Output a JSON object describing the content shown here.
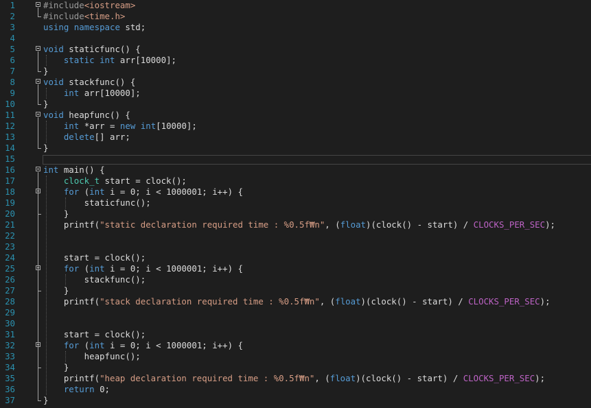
{
  "editor": {
    "lines": [
      {
        "n": "1",
        "fold": true,
        "tokens": [
          {
            "t": "#include",
            "c": "pp"
          },
          {
            "t": "<iostream>",
            "c": "inc"
          }
        ]
      },
      {
        "n": "2",
        "fold": false,
        "tokens": [
          {
            "t": "#include",
            "c": "pp"
          },
          {
            "t": "<time.h>",
            "c": "inc"
          }
        ]
      },
      {
        "n": "3",
        "fold": false,
        "tokens": [
          {
            "t": "using",
            "c": "kw"
          },
          {
            "t": " "
          },
          {
            "t": "namespace",
            "c": "kw"
          },
          {
            "t": " std;"
          }
        ]
      },
      {
        "n": "4",
        "fold": false,
        "tokens": []
      },
      {
        "n": "5",
        "fold": true,
        "tokens": [
          {
            "t": "void",
            "c": "kw"
          },
          {
            "t": " staticfunc() {"
          }
        ]
      },
      {
        "n": "6",
        "fold": false,
        "tokens": [
          {
            "t": "    "
          },
          {
            "t": "static",
            "c": "kw"
          },
          {
            "t": " "
          },
          {
            "t": "int",
            "c": "kw"
          },
          {
            "t": " arr[10000];"
          }
        ]
      },
      {
        "n": "7",
        "fold": false,
        "tokens": [
          {
            "t": "}"
          }
        ]
      },
      {
        "n": "8",
        "fold": true,
        "tokens": [
          {
            "t": "void",
            "c": "kw"
          },
          {
            "t": " stackfunc() {"
          }
        ]
      },
      {
        "n": "9",
        "fold": false,
        "tokens": [
          {
            "t": "    "
          },
          {
            "t": "int",
            "c": "kw"
          },
          {
            "t": " arr[10000];"
          }
        ]
      },
      {
        "n": "10",
        "fold": false,
        "tokens": [
          {
            "t": "}"
          }
        ]
      },
      {
        "n": "11",
        "fold": true,
        "tokens": [
          {
            "t": "void",
            "c": "kw"
          },
          {
            "t": " heapfunc() {"
          }
        ]
      },
      {
        "n": "12",
        "fold": false,
        "tokens": [
          {
            "t": "    "
          },
          {
            "t": "int",
            "c": "kw"
          },
          {
            "t": " *arr = "
          },
          {
            "t": "new",
            "c": "kw"
          },
          {
            "t": " "
          },
          {
            "t": "int",
            "c": "kw"
          },
          {
            "t": "[10000];"
          }
        ]
      },
      {
        "n": "13",
        "fold": false,
        "tokens": [
          {
            "t": "    "
          },
          {
            "t": "delete",
            "c": "kw"
          },
          {
            "t": "[] arr;"
          }
        ]
      },
      {
        "n": "14",
        "fold": false,
        "tokens": [
          {
            "t": "}"
          }
        ]
      },
      {
        "n": "15",
        "fold": false,
        "tokens": []
      },
      {
        "n": "16",
        "fold": true,
        "tokens": [
          {
            "t": "int",
            "c": "kw"
          },
          {
            "t": " main() {"
          }
        ]
      },
      {
        "n": "17",
        "fold": false,
        "tokens": [
          {
            "t": "    "
          },
          {
            "t": "clock_t",
            "c": "typ"
          },
          {
            "t": " start = clock();"
          }
        ]
      },
      {
        "n": "18",
        "fold": true,
        "tokens": [
          {
            "t": "    "
          },
          {
            "t": "for",
            "c": "kw"
          },
          {
            "t": " ("
          },
          {
            "t": "int",
            "c": "kw"
          },
          {
            "t": " i = 0; i < 1000001; i++) {"
          }
        ]
      },
      {
        "n": "19",
        "fold": false,
        "tokens": [
          {
            "t": "        staticfunc();"
          }
        ]
      },
      {
        "n": "20",
        "fold": false,
        "tokens": [
          {
            "t": "    }"
          }
        ]
      },
      {
        "n": "21",
        "fold": false,
        "tokens": [
          {
            "t": "    printf("
          },
          {
            "t": "\"static declaration required time : %0.5f₩n\"",
            "c": "str"
          },
          {
            "t": ", ("
          },
          {
            "t": "float",
            "c": "kw"
          },
          {
            "t": ")(clock() - start) / "
          },
          {
            "t": "CLOCKS_PER_SEC",
            "c": "mac"
          },
          {
            "t": ");"
          }
        ]
      },
      {
        "n": "22",
        "fold": false,
        "tokens": []
      },
      {
        "n": "23",
        "fold": false,
        "tokens": []
      },
      {
        "n": "24",
        "fold": false,
        "tokens": [
          {
            "t": "    start = clock();"
          }
        ]
      },
      {
        "n": "25",
        "fold": true,
        "tokens": [
          {
            "t": "    "
          },
          {
            "t": "for",
            "c": "kw"
          },
          {
            "t": " ("
          },
          {
            "t": "int",
            "c": "kw"
          },
          {
            "t": " i = 0; i < 1000001; i++) {"
          }
        ]
      },
      {
        "n": "26",
        "fold": false,
        "tokens": [
          {
            "t": "        stackfunc();"
          }
        ]
      },
      {
        "n": "27",
        "fold": false,
        "tokens": [
          {
            "t": "    }"
          }
        ]
      },
      {
        "n": "28",
        "fold": false,
        "tokens": [
          {
            "t": "    printf("
          },
          {
            "t": "\"stack declaration required time : %0.5f₩n\"",
            "c": "str"
          },
          {
            "t": ", ("
          },
          {
            "t": "float",
            "c": "kw"
          },
          {
            "t": ")(clock() - start) / "
          },
          {
            "t": "CLOCKS_PER_SEC",
            "c": "mac"
          },
          {
            "t": ");"
          }
        ]
      },
      {
        "n": "29",
        "fold": false,
        "tokens": []
      },
      {
        "n": "30",
        "fold": false,
        "tokens": []
      },
      {
        "n": "31",
        "fold": false,
        "tokens": [
          {
            "t": "    start = clock();"
          }
        ]
      },
      {
        "n": "32",
        "fold": true,
        "tokens": [
          {
            "t": "    "
          },
          {
            "t": "for",
            "c": "kw"
          },
          {
            "t": " ("
          },
          {
            "t": "int",
            "c": "kw"
          },
          {
            "t": " i = 0; i < 1000001; i++) {"
          }
        ]
      },
      {
        "n": "33",
        "fold": false,
        "tokens": [
          {
            "t": "        heapfunc();"
          }
        ]
      },
      {
        "n": "34",
        "fold": false,
        "tokens": [
          {
            "t": "    }"
          }
        ]
      },
      {
        "n": "35",
        "fold": false,
        "tokens": [
          {
            "t": "    printf("
          },
          {
            "t": "\"heap declaration required time : %0.5f₩n\"",
            "c": "str"
          },
          {
            "t": ", ("
          },
          {
            "t": "float",
            "c": "kw"
          },
          {
            "t": ")(clock() - start) / "
          },
          {
            "t": "CLOCKS_PER_SEC",
            "c": "mac"
          },
          {
            "t": ");"
          }
        ]
      },
      {
        "n": "36",
        "fold": false,
        "tokens": [
          {
            "t": "    "
          },
          {
            "t": "return",
            "c": "kw"
          },
          {
            "t": " 0;"
          }
        ]
      },
      {
        "n": "37",
        "fold": false,
        "tokens": [
          {
            "t": "}"
          }
        ]
      }
    ]
  },
  "colors": {
    "background": "#1e1e1e",
    "line_number": "#2b91af",
    "keyword": "#569cd6",
    "string": "#d69d85",
    "macro": "#bd63c5",
    "type": "#4ec9b0"
  }
}
